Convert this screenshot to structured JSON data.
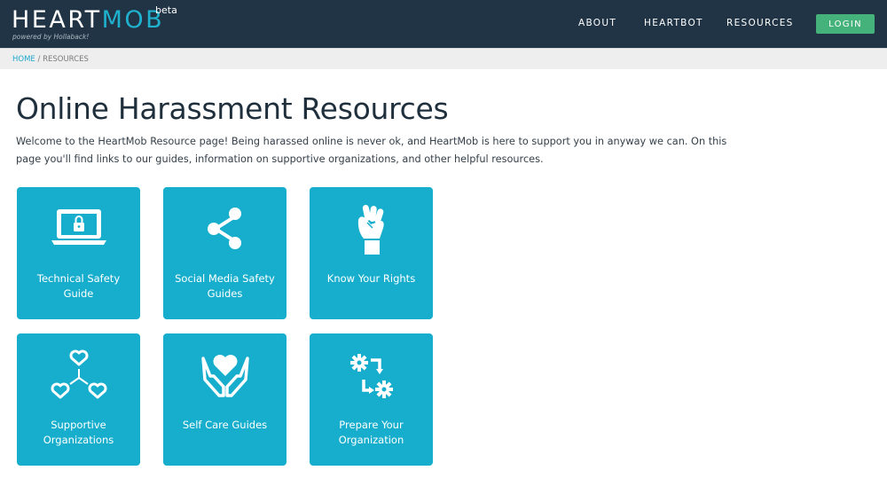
{
  "header": {
    "logo": {
      "word_heart": "HEART",
      "word_mob": "MOB",
      "beta": "beta",
      "tagline": "powered by Hollaback!"
    },
    "nav": {
      "about": "ABOUT",
      "heartbot": "HEARTBOT",
      "resources": "RESOURCES"
    },
    "login_label": "LOGIN"
  },
  "breadcrumb": {
    "home": "HOME",
    "separator": "/",
    "current": "RESOURCES"
  },
  "main": {
    "title": "Online Harassment Resources",
    "intro": "Welcome to the HeartMob Resource page! Being harassed online is never ok, and HeartMob is here to support you in anyway we can. On this page you'll find links to our guides, information on supportive organizations, and other helpful resources.",
    "tiles": [
      {
        "label": "Technical Safety Guide",
        "icon": "laptop-lock-icon"
      },
      {
        "label": "Social Media Safety Guides",
        "icon": "share-icon"
      },
      {
        "label": "Know Your Rights",
        "icon": "raised-fist-icon"
      },
      {
        "label": "Supportive Organizations",
        "icon": "connected-hearts-icon"
      },
      {
        "label": "Self Care Guides",
        "icon": "hands-heart-icon"
      },
      {
        "label": "Prepare Your Organization",
        "icon": "gears-arrows-icon"
      }
    ]
  },
  "colors": {
    "header_bg": "#213445",
    "brand_accent": "#1fb2cf",
    "tile_bg": "#16aecc",
    "login_bg": "#46b27b",
    "breadcrumb_bg": "#eeeeee"
  }
}
